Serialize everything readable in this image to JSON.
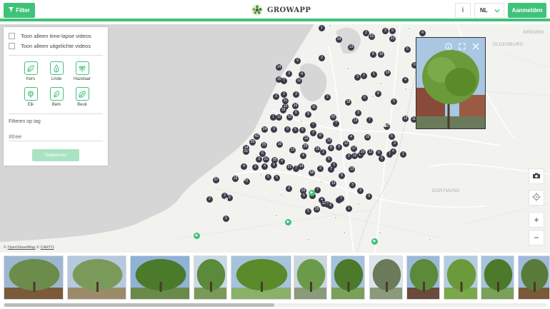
{
  "header": {
    "filter_label": "Filter",
    "brand": "GROWAPP",
    "info_label": "i",
    "language": "NL",
    "login_label": "Aanmelden"
  },
  "filter_panel": {
    "timelapse_label": "Toon alleen time-lapse videos",
    "featured_label": "Toon alleen uitgelichte videos",
    "trees": [
      {
        "name": "Kers",
        "icon": "leaf-icon"
      },
      {
        "name": "Linde",
        "icon": "drop-leaf-icon"
      },
      {
        "name": "Hazelaar",
        "icon": "hazel-icon"
      },
      {
        "name": "Eik",
        "icon": "oak-icon"
      },
      {
        "name": "Berk",
        "icon": "birch-icon"
      },
      {
        "name": "Beuk",
        "icon": "beech-icon"
      }
    ],
    "tag_label": "Filteren op tag",
    "tag_placeholder": "#tree",
    "apply_label": "Toepassen"
  },
  "map": {
    "places": [
      "BREMEN",
      "OLDENBURG",
      "DORTMUND"
    ],
    "attribution_prefix": "©",
    "attribution_osm": "OpenStreetMap",
    "attribution_sep": ",©",
    "attribution_carto": "CARTO",
    "markers": [
      "1",
      "2",
      "3",
      "5",
      "14",
      "22",
      "23",
      "4",
      "8",
      "10",
      "5",
      "13",
      "2",
      "9",
      "14",
      "3",
      "4",
      "15",
      "7",
      "12",
      "3",
      "2",
      "1",
      "10",
      "4",
      "6",
      "3",
      "2",
      "8",
      "19",
      "6",
      "5",
      "3",
      "2",
      "21",
      "15",
      "16",
      "19",
      "10",
      "6",
      "1",
      "12",
      "11",
      "9",
      "20",
      "3",
      "7",
      "10",
      "13",
      "11",
      "7",
      "7",
      "13",
      "24",
      "9",
      "9",
      "5",
      "6",
      "2",
      "8",
      "42",
      "26",
      "14",
      "25",
      "6",
      "3",
      "31",
      "21",
      "35",
      "13",
      "4",
      "16",
      "5",
      "3",
      "13",
      "29",
      "15",
      "8",
      "9",
      "12",
      "17",
      "10",
      "6",
      "7",
      "4",
      "2",
      "10",
      "13",
      "4",
      "3",
      "5",
      "3",
      "2",
      "12",
      "10",
      "12",
      "5",
      "2",
      "4",
      "9",
      "4",
      "21",
      "14",
      "3",
      "7",
      "8",
      "13",
      "4",
      "16",
      "3",
      "6",
      "5",
      "7",
      "38",
      "37",
      "2",
      "33",
      "7",
      "13",
      "4",
      "3",
      "4",
      "3",
      "3",
      "2",
      "2",
      "8",
      "5",
      "4",
      "12",
      "4",
      "5",
      "15",
      "7",
      "1",
      "9",
      "5"
    ]
  },
  "popup": {
    "info_icon": "info-icon",
    "expand_icon": "expand-icon",
    "close_icon": "close-icon"
  },
  "controls": {
    "camera_icon": "camera-icon",
    "locate_icon": "locate-icon",
    "zoom_in": "+",
    "zoom_out": "−"
  },
  "thumbnails": 13
}
